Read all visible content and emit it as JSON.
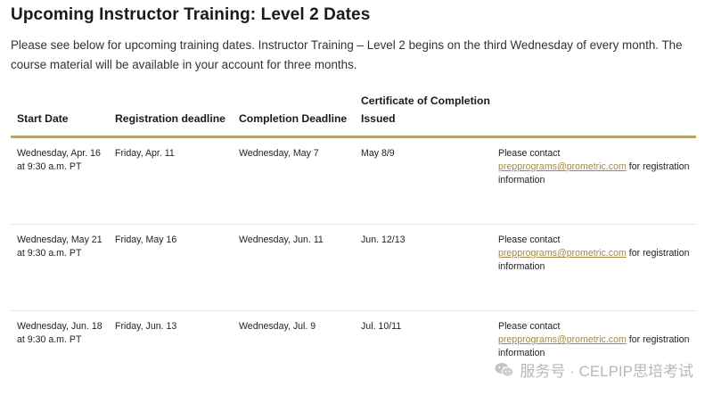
{
  "title": "Upcoming Instructor Training: Level 2 Dates",
  "intro": "Please see below for upcoming training dates.  Instructor Training – Level 2 begins on the third Wednesday of every month. The course material will be available in your account for three months.",
  "table": {
    "headers": [
      "Start Date",
      "Registration deadline",
      "Completion Deadline",
      "Certificate of Completion Issued"
    ],
    "rows": [
      {
        "start": "Wednesday, Apr. 16 at 9:30 a.m. PT",
        "registration": "Friday, Apr. 11",
        "completion": "Wednesday, May 7",
        "certificate": "May 8/9",
        "contact_prefix": "Please contact",
        "contact_email": "prepprograms@prometric.com",
        "contact_suffix": "for registration information"
      },
      {
        "start": "Wednesday, May 21 at 9:30 a.m. PT",
        "registration": "Friday, May 16",
        "completion": "Wednesday, Jun. 11",
        "certificate": "Jun. 12/13",
        "contact_prefix": "Please contact",
        "contact_email": "prepprograms@prometric.com",
        "contact_suffix": "for registration information"
      },
      {
        "start": "Wednesday, Jun. 18 at 9:30 a.m. PT",
        "registration": "Friday, Jun. 13",
        "completion": "Wednesday, Jul. 9",
        "certificate": "Jul. 10/11",
        "contact_prefix": "Please contact",
        "contact_email": "prepprograms@prometric.com",
        "contact_suffix": "for registration information"
      }
    ]
  },
  "watermark": {
    "text": "服务号 · CELPIP思培考试",
    "icon": "wechat-icon"
  },
  "colors": {
    "accent": "#b8a36a",
    "link": "#a38a4a"
  }
}
